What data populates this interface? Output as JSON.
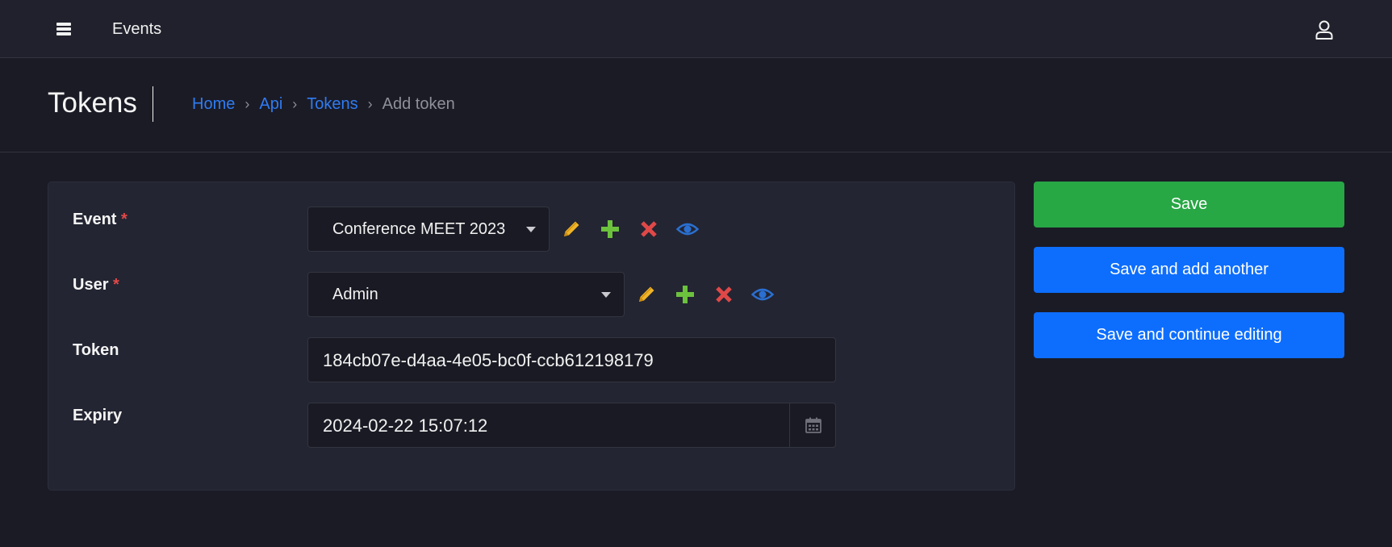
{
  "topbar": {
    "title": "Events",
    "menu_icon": "hamburger-menu-icon",
    "user_icon": "user-icon"
  },
  "header": {
    "page_title": "Tokens",
    "breadcrumb": {
      "home": "Home",
      "api": "Api",
      "tokens": "Tokens",
      "current": "Add token",
      "separator": "›"
    }
  },
  "form": {
    "event": {
      "label": "Event",
      "required_mark": "*",
      "value": "Conference MEET 2023",
      "icons": [
        "pencil-icon",
        "plus-icon",
        "delete-x-icon",
        "eye-icon"
      ]
    },
    "user": {
      "label": "User",
      "required_mark": "*",
      "value": "Admin",
      "icons": [
        "pencil-icon",
        "plus-icon",
        "delete-x-icon",
        "eye-icon"
      ]
    },
    "token": {
      "label": "Token",
      "value": "184cb07e-d4aa-4e05-bc0f-ccb612198179"
    },
    "expiry": {
      "label": "Expiry",
      "value": "2024-02-22 15:07:12",
      "icon": "calendar-icon"
    }
  },
  "actions": {
    "save": "Save",
    "save_add_another": "Save and add another",
    "save_continue": "Save and continue editing"
  },
  "colors": {
    "background": "#1b1b26",
    "card": "#232532",
    "link": "#2f7cf2",
    "save": "#28a745",
    "primary": "#0d6efd",
    "pencil": "#f0b429",
    "plus": "#6cc13d",
    "delete": "#e04848",
    "eye": "#2a6fd1",
    "required": "#e04848"
  }
}
